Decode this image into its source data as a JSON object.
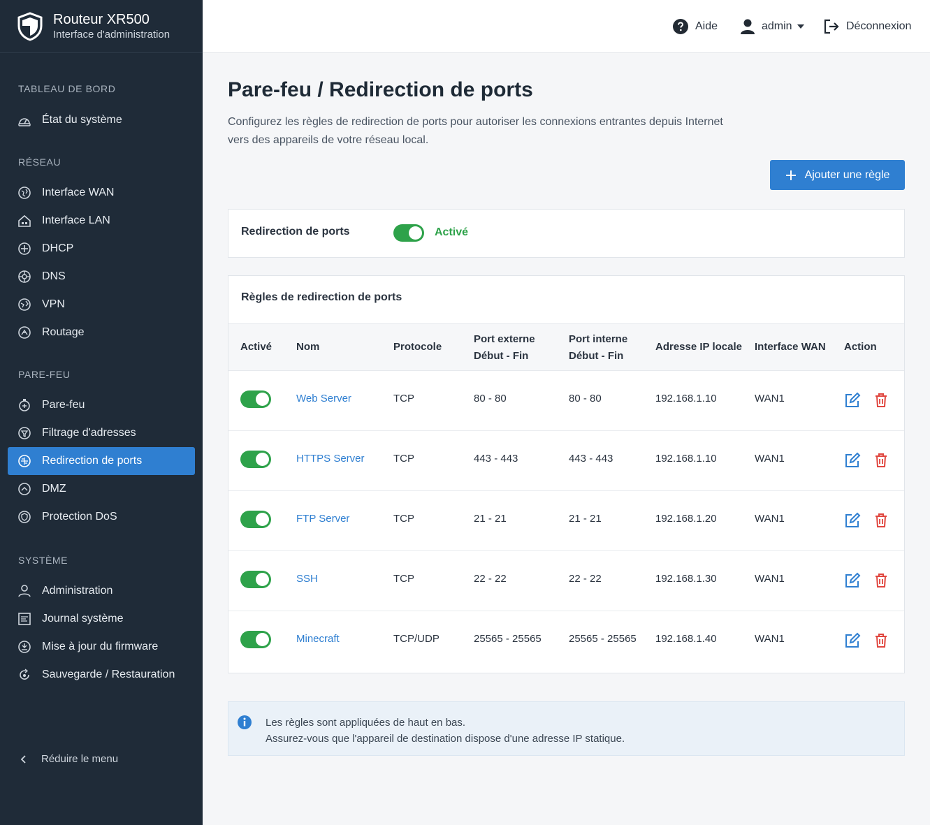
{
  "brand": {
    "title": "Routeur XR500",
    "subtitle": "Interface d'administration"
  },
  "topbar": {
    "help_label": "Aide",
    "user_label": "admin",
    "logout_label": "Déconnexion"
  },
  "sidebar": {
    "sections": [
      {
        "title": "TABLEAU DE BORD",
        "items": [
          {
            "label": "État du système",
            "icon": "dashboard-icon"
          }
        ]
      },
      {
        "title": "RÉSEAU",
        "items": [
          {
            "label": "Interface WAN",
            "icon": "globe-icon"
          },
          {
            "label": "Interface LAN",
            "icon": "house-icon"
          },
          {
            "label": "DHCP",
            "icon": "dhcp-icon"
          },
          {
            "label": "DNS",
            "icon": "dns-icon"
          },
          {
            "label": "VPN",
            "icon": "vpn-icon"
          },
          {
            "label": "Routage",
            "icon": "routing-icon"
          }
        ]
      },
      {
        "title": "PARE-FEU",
        "items": [
          {
            "label": "Pare-feu",
            "icon": "firewall-icon"
          },
          {
            "label": "Filtrage d'adresses",
            "icon": "filter-icon"
          },
          {
            "label": "Redirection de ports",
            "icon": "port-forward-icon",
            "active": true
          },
          {
            "label": "DMZ",
            "icon": "dmz-icon"
          },
          {
            "label": "Protection DoS",
            "icon": "shield-icon"
          }
        ]
      },
      {
        "title": "SYSTÈME",
        "items": [
          {
            "label": "Administration",
            "icon": "user-icon"
          },
          {
            "label": "Journal système",
            "icon": "log-icon"
          },
          {
            "label": "Mise à jour du firmware",
            "icon": "update-icon"
          },
          {
            "label": "Sauvegarde / Restauration",
            "icon": "backup-icon"
          }
        ]
      }
    ],
    "collapse_label": "Réduire le menu"
  },
  "page": {
    "title": "Pare-feu / Redirection de ports",
    "description": "Configurez les règles de redirection de ports pour autoriser les connexions entrantes depuis Internet vers des appareils de votre réseau local.",
    "add_button_label": "Ajouter une règle"
  },
  "forwarding": {
    "label": "Redirection de ports",
    "enabled": true,
    "state_label": "Activé"
  },
  "rules_table": {
    "title": "Règles de redirection de ports",
    "columns": {
      "active": "Activé",
      "name": "Nom",
      "protocol": "Protocole",
      "ext_port_line1": "Port externe",
      "ext_port_line2": "Début - Fin",
      "int_port_line1": "Port interne",
      "int_port_line2": "Début - Fin",
      "local_ip": "Adresse IP locale",
      "wan": "Interface WAN",
      "action": "Action"
    },
    "rows": [
      {
        "enabled": true,
        "name": "Web Server",
        "protocol": "TCP",
        "ext": "80 - 80",
        "int": "80 - 80",
        "ip": "192.168.1.10",
        "wan": "WAN1"
      },
      {
        "enabled": true,
        "name": "HTTPS Server",
        "protocol": "TCP",
        "ext": "443 - 443",
        "int": "443 - 443",
        "ip": "192.168.1.10",
        "wan": "WAN1"
      },
      {
        "enabled": true,
        "name": "FTP Server",
        "protocol": "TCP",
        "ext": "21 - 21",
        "int": "21 - 21",
        "ip": "192.168.1.20",
        "wan": "WAN1"
      },
      {
        "enabled": true,
        "name": "SSH",
        "protocol": "TCP",
        "ext": "22 - 22",
        "int": "22 - 22",
        "ip": "192.168.1.30",
        "wan": "WAN1"
      },
      {
        "enabled": true,
        "name": "Minecraft",
        "protocol": "TCP/UDP",
        "ext": "25565 - 25565",
        "int": "25565 - 25565",
        "ip": "192.168.1.40",
        "wan": "WAN1"
      }
    ]
  },
  "info": {
    "line1": "Les règles sont appliquées de haut en bas.",
    "line2": "Assurez-vous que l'appareil de destination dispose d'une adresse IP statique."
  },
  "colors": {
    "sidebar_bg": "#1f2b38",
    "accent": "#2f7fd1",
    "success": "#2ea24a",
    "danger": "#e0463f"
  }
}
